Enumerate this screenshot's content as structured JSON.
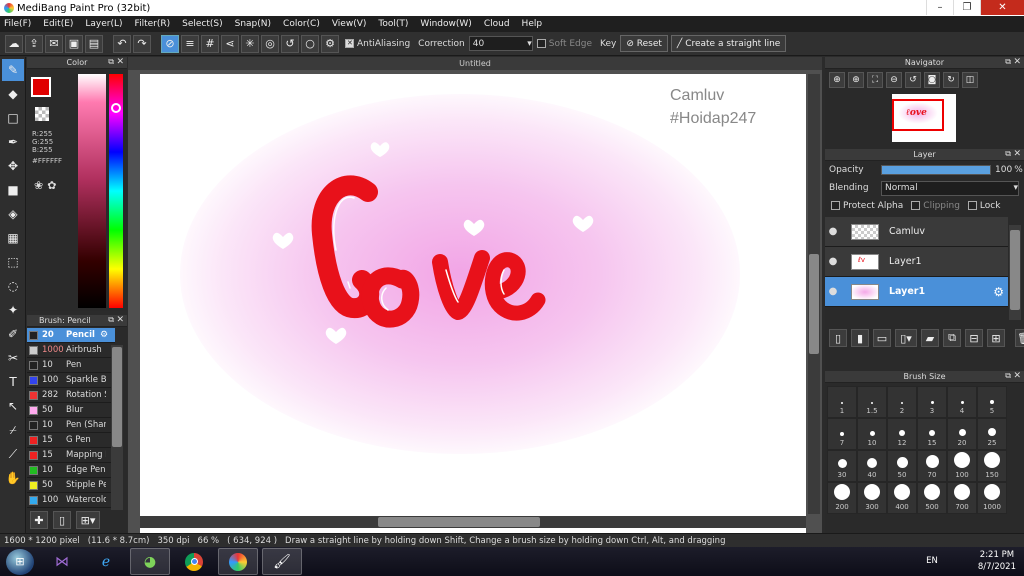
{
  "window": {
    "title": "MediBang Paint Pro (32bit)"
  },
  "menu": [
    "File(F)",
    "Edit(E)",
    "Layer(L)",
    "Filter(R)",
    "Select(S)",
    "Snap(N)",
    "Color(C)",
    "View(V)",
    "Tool(T)",
    "Window(W)",
    "Cloud",
    "Help"
  ],
  "toolbar": {
    "antialiasing": "AntiAliasing",
    "correction_label": "Correction",
    "correction_value": "40",
    "soft_edge": "Soft Edge",
    "key_label": "Key",
    "reset_label": "Reset",
    "straight_line_label": "Create a straight line"
  },
  "color_panel": {
    "title": "Color",
    "r": "R:255",
    "g": "G:255",
    "b": "B:255",
    "hex": "#FFFFFF",
    "foreground": "#e00000",
    "background": "#ffffff"
  },
  "brush_panel": {
    "title": "Brush: Pencil",
    "items": [
      {
        "size": "20",
        "name": "Pencil",
        "color": "#222222"
      },
      {
        "size": "1000",
        "name": "Airbrush",
        "color": "#cccccc"
      },
      {
        "size": "10",
        "name": "Pen",
        "color": "#222222"
      },
      {
        "size": "100",
        "name": "Sparkle Br",
        "color": "#3344ee"
      },
      {
        "size": "282",
        "name": "Rotation S",
        "color": "#ee3333"
      },
      {
        "size": "50",
        "name": "Blur",
        "color": "#ffaaee"
      },
      {
        "size": "10",
        "name": "Pen (Shar",
        "color": "#222222"
      },
      {
        "size": "15",
        "name": "G Pen",
        "color": "#ee2222"
      },
      {
        "size": "15",
        "name": "Mapping P",
        "color": "#ee2222"
      },
      {
        "size": "10",
        "name": "Edge Pen",
        "color": "#22bb22"
      },
      {
        "size": "50",
        "name": "Stipple Pe",
        "color": "#eeee22"
      },
      {
        "size": "100",
        "name": "Watercolo",
        "color": "#33aaee"
      }
    ]
  },
  "document": {
    "tab": "Untitled",
    "watermark_line1": "Camluv",
    "watermark_line2": "#Hoidap247"
  },
  "navigator": {
    "title": "Navigator"
  },
  "layer_panel": {
    "title": "Layer",
    "opacity_label": "Opacity",
    "opacity_value": "100",
    "opacity_unit": "%",
    "opacity_fraction": 1.0,
    "blending_label": "Blending",
    "blending_value": "Normal",
    "protect_alpha": "Protect Alpha",
    "clipping": "Clipping",
    "lock": "Lock",
    "layers": [
      "Camluv",
      "Layer1",
      "Layer1"
    ]
  },
  "brush_size_panel": {
    "title": "Brush Size",
    "sizes": [
      "1",
      "1.5",
      "2",
      "3",
      "4",
      "5",
      "7",
      "10",
      "12",
      "15",
      "20",
      "25",
      "30",
      "40",
      "50",
      "70",
      "100",
      "150",
      "200",
      "300",
      "400",
      "500",
      "700",
      "1000"
    ]
  },
  "status": {
    "dims": "1600 * 1200 pixel",
    "physical": "(11.6 * 8.7cm)",
    "dpi": "350 dpi",
    "zoom": "66 %",
    "coords": "( 634, 924 )",
    "hint": "Draw a straight line by holding down Shift, Change a brush size by holding down Ctrl, Alt, and dragging"
  },
  "taskbar": {
    "lang": "EN",
    "time": "2:21 PM",
    "date": "8/7/2021"
  },
  "colors": {
    "accent": "#4a90d9",
    "ink": "#e8111a"
  }
}
